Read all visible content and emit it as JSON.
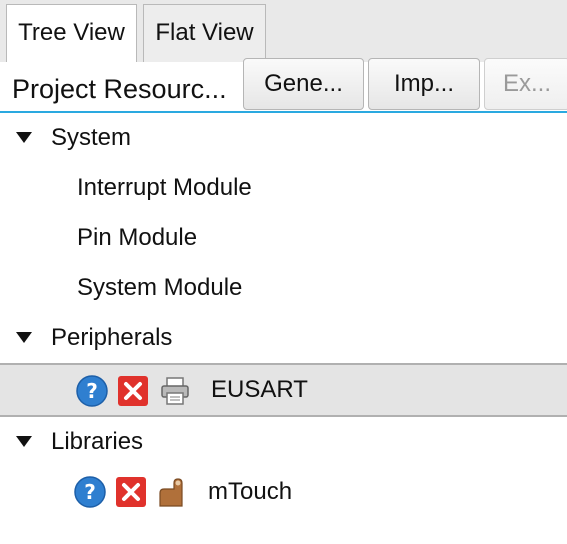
{
  "tabs": [
    {
      "label": "Tree View",
      "active": true
    },
    {
      "label": "Flat View",
      "active": false
    }
  ],
  "header": {
    "title": "Project Resourc...",
    "buttons": [
      {
        "label": "Gene...",
        "enabled": true
      },
      {
        "label": "Imp...",
        "enabled": true
      },
      {
        "label": "Ex...",
        "enabled": false
      }
    ]
  },
  "tree": {
    "system": {
      "label": "System",
      "children": [
        "Interrupt Module",
        "Pin Module",
        "System Module"
      ]
    },
    "peripherals": {
      "label": "Peripherals",
      "children": [
        {
          "label": "EUSART",
          "icons": [
            "help-icon",
            "remove-icon",
            "printer-icon"
          ]
        }
      ]
    },
    "libraries": {
      "label": "Libraries",
      "children": [
        {
          "label": "mTouch",
          "icons": [
            "help-icon",
            "remove-icon",
            "touch-hand-icon"
          ]
        }
      ]
    }
  },
  "colors": {
    "accent_line": "#2aa9e0",
    "help_blue": "#2f7fd0",
    "remove_red": "#e0322c",
    "selection": "#e4e4e4"
  }
}
